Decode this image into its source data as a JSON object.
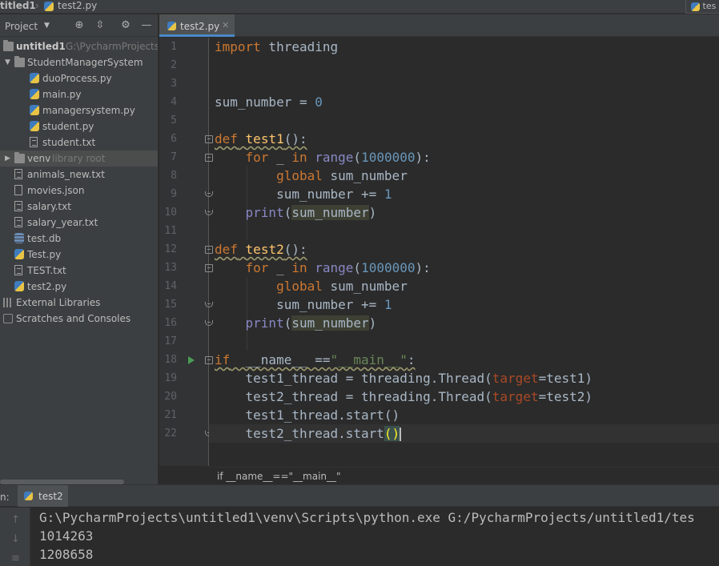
{
  "navbar": {
    "project_crumb": "titled1",
    "file_crumb": "test2.py",
    "right_tab": "tes"
  },
  "project_panel": {
    "title": "Project",
    "tree": [
      {
        "label": "untitled1",
        "hint": "G:\\PycharmProjects\\",
        "icon": "folder-icon",
        "level": 0,
        "expanded": true,
        "bold": true
      },
      {
        "label": "StudentManagerSystem",
        "icon": "folder-icon",
        "level": 1,
        "expanded": true
      },
      {
        "label": "duoProcess.py",
        "icon": "python-file-icon",
        "level": 2
      },
      {
        "label": "main.py",
        "icon": "python-file-icon",
        "level": 2
      },
      {
        "label": "managersystem.py",
        "icon": "python-file-icon",
        "level": 2
      },
      {
        "label": "student.py",
        "icon": "python-file-icon",
        "level": 2
      },
      {
        "label": "student.txt",
        "icon": "text-file-icon",
        "level": 2
      },
      {
        "label": "venv",
        "hint": "library root",
        "icon": "folder-icon",
        "level": 1,
        "expanded": false,
        "selected": true
      },
      {
        "label": "animals_new.txt",
        "icon": "text-file-icon",
        "level": 1
      },
      {
        "label": "movies.json",
        "icon": "json-file-icon",
        "level": 1
      },
      {
        "label": "salary.txt",
        "icon": "text-file-icon",
        "level": 1
      },
      {
        "label": "salary_year.txt",
        "icon": "text-file-icon",
        "level": 1
      },
      {
        "label": "test.db",
        "icon": "database-file-icon",
        "level": 1
      },
      {
        "label": "Test.py",
        "icon": "python-file-icon",
        "level": 1
      },
      {
        "label": "TEST.txt",
        "icon": "text-file-icon",
        "level": 1
      },
      {
        "label": "test2.py",
        "icon": "python-file-icon",
        "level": 1
      },
      {
        "label": "External Libraries",
        "icon": "libraries-icon",
        "level": 0
      },
      {
        "label": "Scratches and Consoles",
        "icon": "scratches-icon",
        "level": 0
      }
    ]
  },
  "editor": {
    "tab_label": "test2.py",
    "line_numbers": [
      "1",
      "2",
      "3",
      "4",
      "5",
      "6",
      "7",
      "8",
      "9",
      "10",
      "11",
      "12",
      "13",
      "14",
      "15",
      "16",
      "17",
      "18",
      "19",
      "20",
      "21",
      "22"
    ],
    "breadcrumb": "if __name__==\"__main__\""
  },
  "run_panel": {
    "label": "n:",
    "tab_label": "test2",
    "output": [
      "G:\\PycharmProjects\\untitled1\\venv\\Scripts\\python.exe G:/PycharmProjects/untitled1/tes",
      "1014263",
      "1208658"
    ]
  },
  "colors": {
    "background": "#2b2b2b",
    "panel": "#3c3f41",
    "keyword": "#cc7832",
    "function": "#ffc66d",
    "number": "#6897bb",
    "builtin": "#8888c6",
    "string": "#6a8759",
    "param": "#aa4926",
    "accent": "#4a88c7"
  }
}
